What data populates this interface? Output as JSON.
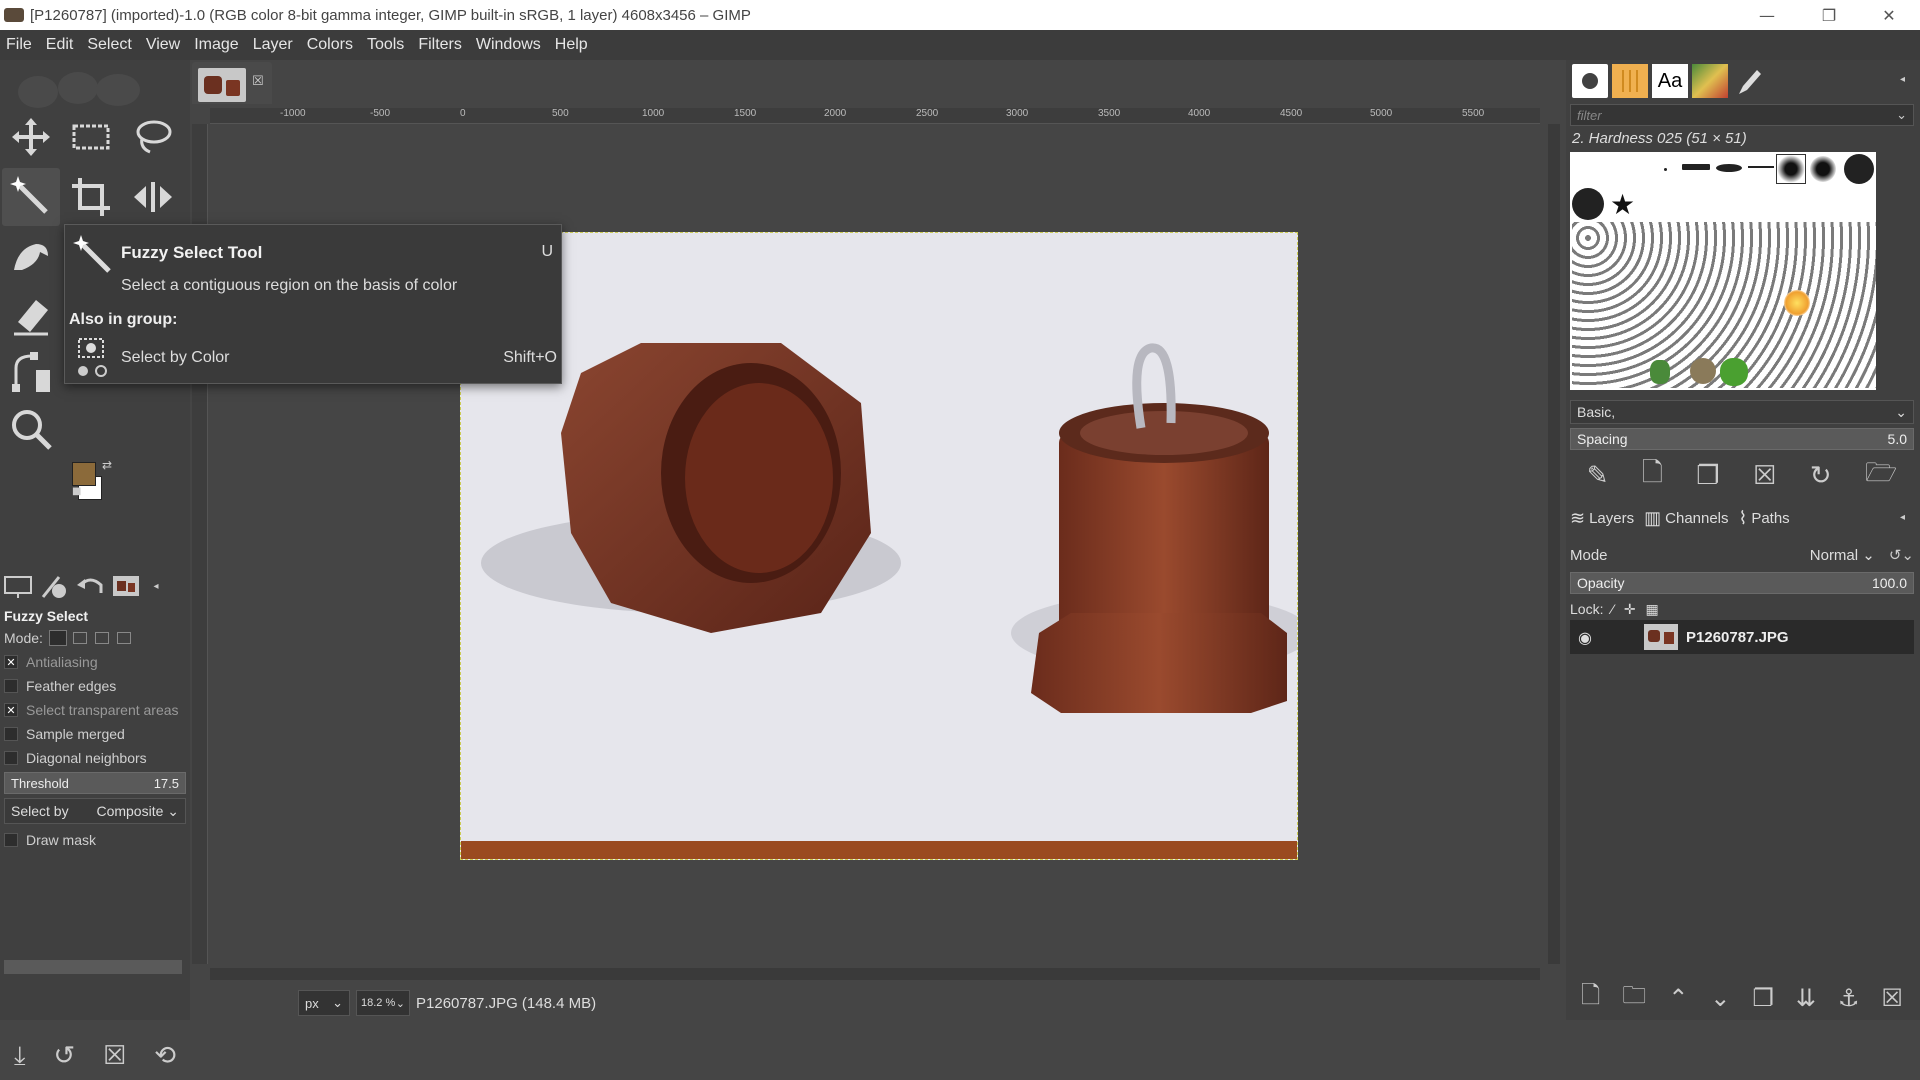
{
  "window": {
    "title": "[P1260787] (imported)-1.0 (RGB color 8-bit gamma integer, GIMP built-in sRGB, 1 layer) 4608x3456 – GIMP",
    "controls": {
      "minimize": "—",
      "maximize": "❐",
      "close": "✕"
    }
  },
  "menu": [
    "File",
    "Edit",
    "Select",
    "View",
    "Image",
    "Layer",
    "Colors",
    "Tools",
    "Filters",
    "Windows",
    "Help"
  ],
  "tooltip": {
    "title": "Fuzzy Select Tool",
    "shortcut": "U",
    "description": "Select a contiguous region on the basis of color",
    "group_heading": "Also in group:",
    "group_item": "Select by Color",
    "group_item_shortcut": "Shift+O"
  },
  "tool_options": {
    "title": "Fuzzy Select",
    "mode_label": "Mode:",
    "antialiasing": "Antialiasing",
    "feather_edges": "Feather edges",
    "select_transparent": "Select transparent areas",
    "sample_merged": "Sample merged",
    "diagonal_neighbors": "Diagonal neighbors",
    "threshold_label": "Threshold",
    "threshold_value": "17.5",
    "select_by_label": "Select by",
    "select_by_value": "Composite",
    "draw_mask": "Draw mask"
  },
  "rulers": {
    "h_ticks": [
      "-1000",
      "-500",
      "0",
      "500",
      "1000",
      "1500",
      "2000",
      "2500",
      "3000",
      "3500",
      "4000",
      "4500",
      "5000",
      "5500"
    ]
  },
  "status": {
    "unit": "px",
    "zoom": "18.2 %",
    "text": "P1260787.JPG (148.4 MB)"
  },
  "brushes": {
    "tab_text": "Aa",
    "filter_placeholder": "filter",
    "selected_brush": "2. Hardness 025 (51 × 51)",
    "preset": "Basic,",
    "spacing_label": "Spacing",
    "spacing_value": "5.0"
  },
  "layers": {
    "tabs": [
      "Layers",
      "Channels",
      "Paths"
    ],
    "mode_label": "Mode",
    "mode_value": "Normal",
    "opacity_label": "Opacity",
    "opacity_value": "100.0",
    "lock_label": "Lock:",
    "layer_name": "P1260787.JPG"
  },
  "colors": {
    "foreground": "#8b6a3a",
    "background": "#ffffff",
    "canvas_bg": "#454545",
    "wood": "#7a3522"
  }
}
